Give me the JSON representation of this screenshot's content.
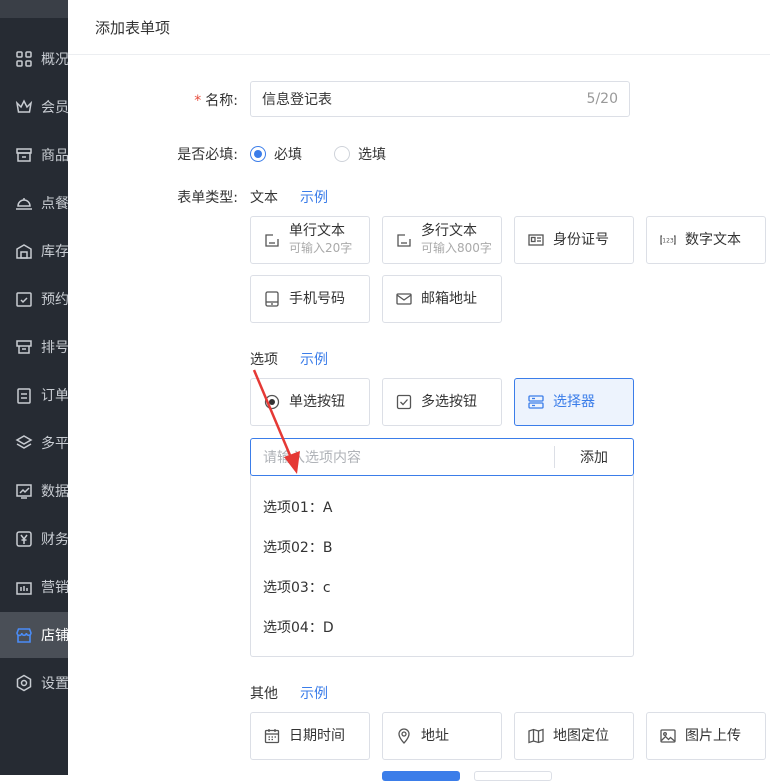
{
  "sidebar": {
    "items": [
      {
        "label": "概况",
        "icon": "grid-icon"
      },
      {
        "label": "会员",
        "icon": "crown-icon"
      },
      {
        "label": "商品",
        "icon": "shop-icon"
      },
      {
        "label": "点餐",
        "icon": "dish-cover-icon"
      },
      {
        "label": "库存",
        "icon": "warehouse-icon"
      },
      {
        "label": "预约",
        "icon": "calendar-check-icon"
      },
      {
        "label": "排号",
        "icon": "queue-icon"
      },
      {
        "label": "订单",
        "icon": "clipboard-icon"
      },
      {
        "label": "多平",
        "icon": "layers-icon"
      },
      {
        "label": "数据",
        "icon": "chart-icon"
      },
      {
        "label": "财务",
        "icon": "yen-icon"
      },
      {
        "label": "营销",
        "icon": "marketing-icon"
      },
      {
        "label": "店铺",
        "icon": "store-icon",
        "active": true
      },
      {
        "label": "设置",
        "icon": "gear-icon"
      }
    ]
  },
  "header": {
    "title": "添加表单项"
  },
  "form": {
    "name_label": "名称:",
    "name_required_mark": "*",
    "name_value": "信息登记表",
    "name_count": "5/20",
    "required_label": "是否必填:",
    "required_options": [
      "必填",
      "选填"
    ],
    "required_selected": "必填",
    "type_label": "表单类型:",
    "text_section": {
      "title": "文本",
      "example": "示例"
    },
    "text_cards": [
      {
        "label": "单行文本",
        "sub": "可输入20字",
        "icon": "edit-box-icon"
      },
      {
        "label": "多行文本",
        "sub": "可输入800字",
        "icon": "edit-box-icon"
      },
      {
        "label": "身份证号",
        "sub": "",
        "icon": "id-card-icon"
      },
      {
        "label": "数字文本",
        "sub": "",
        "icon": "number-icon"
      },
      {
        "label": "手机号码",
        "sub": "",
        "icon": "phone-icon"
      },
      {
        "label": "邮箱地址",
        "sub": "",
        "icon": "mail-icon"
      }
    ],
    "option_section": {
      "title": "选项",
      "example": "示例"
    },
    "option_cards": [
      {
        "label": "单选按钮",
        "icon": "radio-icon"
      },
      {
        "label": "多选按钮",
        "icon": "checkbox-icon"
      },
      {
        "label": "选择器",
        "icon": "selector-icon",
        "selected": true
      }
    ],
    "option_input": {
      "placeholder": "请输入选项内容",
      "add_label": "添加"
    },
    "option_items": [
      "选项01：A",
      "选项02：B",
      "选项03：c",
      "选项04：D"
    ],
    "other_section": {
      "title": "其他",
      "example": "示例"
    },
    "other_cards": [
      {
        "label": "日期时间",
        "icon": "calendar-icon"
      },
      {
        "label": "地址",
        "icon": "location-pin-icon"
      },
      {
        "label": "地图定位",
        "icon": "map-icon"
      },
      {
        "label": "图片上传",
        "icon": "image-icon"
      }
    ]
  },
  "colors": {
    "accent": "#3b7de9",
    "annotation_arrow": "#e53935",
    "sidebar_bg": "#262b33"
  }
}
